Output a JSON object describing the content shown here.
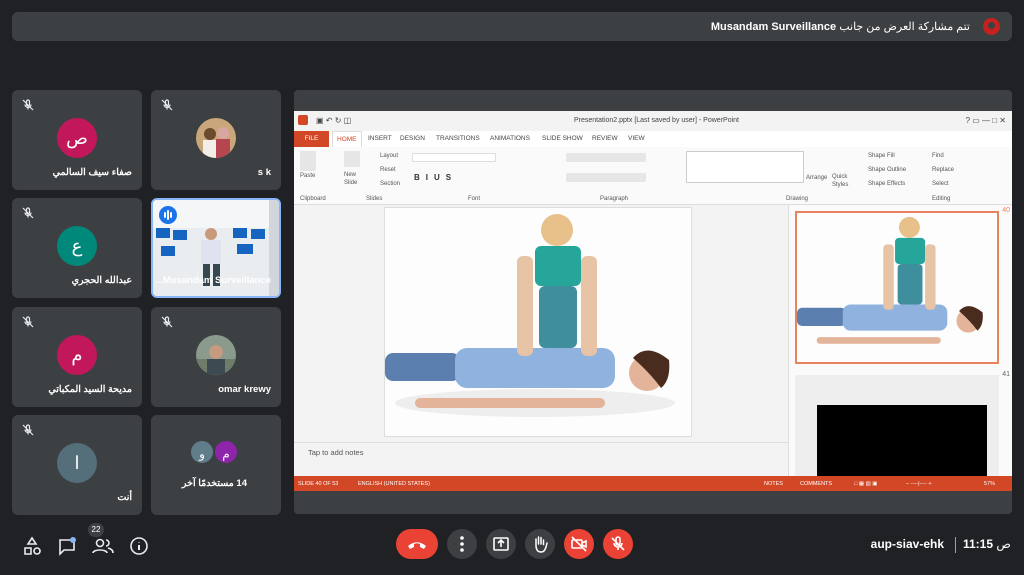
{
  "banner": {
    "presenter": "Musandam Surveillance",
    "text": "تتم مشاركة العرض من جانب"
  },
  "tiles": [
    {
      "name": "صفاء سيف السالمي",
      "initial": "ص",
      "color": "#c2185b"
    },
    {
      "name": "s k"
    },
    {
      "name": "عبدالله الحجري",
      "initial": "ع",
      "color": "#00897b"
    },
    {
      "name": "...Musandam Surveillance"
    },
    {
      "name": "مديحة السيد المكباتي",
      "initial": "م",
      "color": "#c2185b"
    },
    {
      "name": "omar krewy"
    },
    {
      "name": "أنت",
      "initial": "ا",
      "color": "#546e7a"
    },
    {
      "name": "14 مستخدمًا آخر",
      "initial_a": "و",
      "initial_b": "م",
      "color_a": "#607d8b",
      "color_b": "#8e24aa"
    }
  ],
  "powerpoint": {
    "title": "Presentation2.pptx [Last saved by user] - PowerPoint",
    "tabs": [
      "FILE",
      "HOME",
      "INSERT",
      "DESIGN",
      "TRANSITIONS",
      "ANIMATIONS",
      "SLIDE SHOW",
      "REVIEW",
      "VIEW"
    ],
    "groups": [
      "Clipboard",
      "Slides",
      "Font",
      "Paragraph",
      "Drawing",
      "Editing"
    ],
    "buttons": {
      "paste": "Paste",
      "new_slide": "New Slide",
      "layout": "Layout",
      "reset": "Reset",
      "section": "Section",
      "arrange": "Arrange",
      "quick_styles": "Quick Styles",
      "shape_fill": "Shape Fill",
      "shape_outline": "Shape Outline",
      "shape_effects": "Shape Effects",
      "find": "Find",
      "replace": "Replace",
      "select": "Select"
    },
    "notes": "Tap to add notes",
    "thumb_numbers": [
      "40",
      "41"
    ],
    "status": {
      "slide": "SLIDE 40 OF 53",
      "language": "ENGLISH (UNITED STATES)",
      "notes": "NOTES",
      "comments": "COMMENTS",
      "zoom": "57%"
    }
  },
  "bottom": {
    "participant_count": "22",
    "meeting_code": "aup-siav-ehk",
    "time": "11:15",
    "period": "ص"
  }
}
